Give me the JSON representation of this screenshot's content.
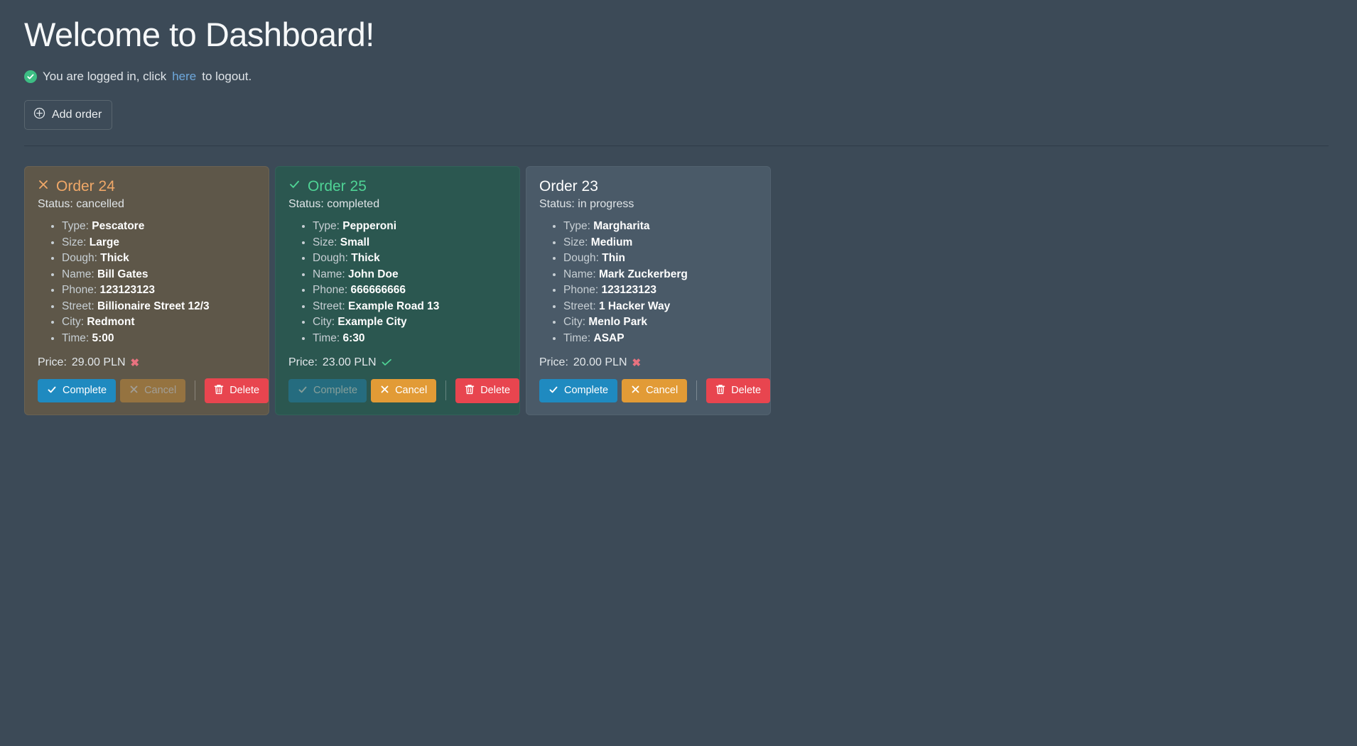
{
  "header": {
    "title": "Welcome to Dashboard!",
    "status_icon": "check-circle-icon",
    "login_text_before": "You are logged in, click",
    "logout_link": "here",
    "login_text_after": "to logout."
  },
  "toolbar": {
    "add_order_label": "Add order",
    "add_order_icon": "plus-circle-icon"
  },
  "labels": {
    "status_prefix": "Status:",
    "type": "Type:",
    "size": "Size:",
    "dough": "Dough:",
    "name": "Name:",
    "phone": "Phone:",
    "street": "Street:",
    "city": "City:",
    "time": "Time:",
    "price_prefix": "Price:",
    "complete": "Complete",
    "cancel": "Cancel",
    "delete": "Delete"
  },
  "colors": {
    "page_bg": "#3c4a57",
    "card_cancelled_bg": "#5e5749",
    "card_completed_bg": "#2b5750",
    "card_progress_bg": "#4a5a68",
    "title_cancelled": "#f0a868",
    "title_completed": "#4fd395",
    "title_progress": "#ffffff",
    "link": "#6ea8dc",
    "complete_btn": "#1f8ac0",
    "cancel_btn": "#e29b36",
    "delete_btn": "#e8454f",
    "check_badge": "#3dbd84",
    "x_mark": "#e8727f"
  },
  "orders": [
    {
      "title": "Order 24",
      "status": "cancelled",
      "status_icon": "x-icon",
      "type": "Pescatore",
      "size": "Large",
      "dough": "Thick",
      "name": "Bill Gates",
      "phone": "123123123",
      "street": "Billionaire Street 12/3",
      "city": "Redmont",
      "time": "5:00",
      "price": "29.00 PLN",
      "price_icon": "x-icon",
      "complete_disabled": false,
      "cancel_disabled": true
    },
    {
      "title": "Order 25",
      "status": "completed",
      "status_icon": "check-icon",
      "type": "Pepperoni",
      "size": "Small",
      "dough": "Thick",
      "name": "John Doe",
      "phone": "666666666",
      "street": "Example Road 13",
      "city": "Example City",
      "time": "6:30",
      "price": "23.00 PLN",
      "price_icon": "check-icon",
      "complete_disabled": true,
      "cancel_disabled": false
    },
    {
      "title": "Order 23",
      "status": "in progress",
      "status_icon": "none",
      "type": "Margharita",
      "size": "Medium",
      "dough": "Thin",
      "name": "Mark Zuckerberg",
      "phone": "123123123",
      "street": "1 Hacker Way",
      "city": "Menlo Park",
      "time": "ASAP",
      "price": "20.00 PLN",
      "price_icon": "x-icon",
      "complete_disabled": false,
      "cancel_disabled": false
    }
  ]
}
